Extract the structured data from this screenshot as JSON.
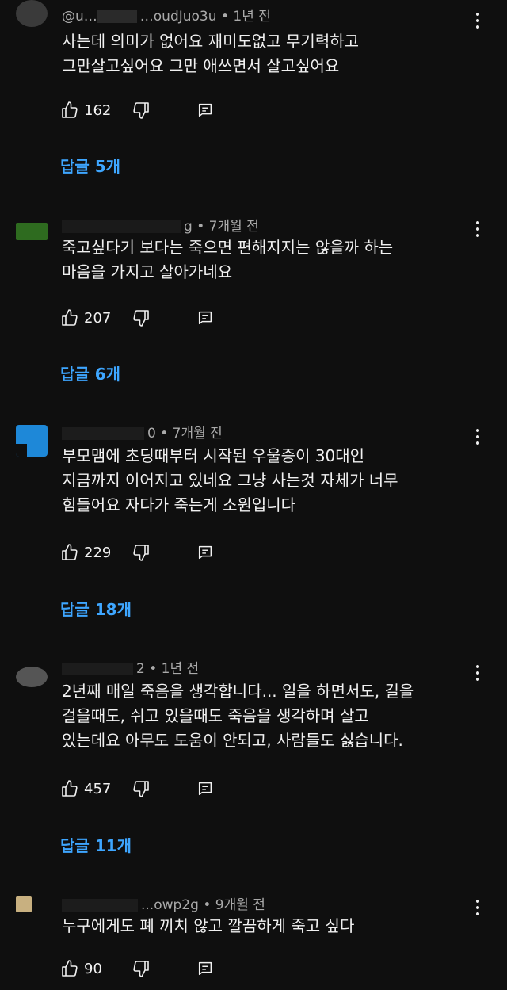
{
  "comments": [
    {
      "author": "@u…",
      "author_tail": "…oudJuo3u",
      "time": "1년 전",
      "text": "사는데 의미가 없어요 재미도없고 무기력하고\n그만살고싶어요 그만 애쓰면서 살고싶어요",
      "likes": "162",
      "replies": "답글 5개",
      "avatar_color": "#3a3a3a"
    },
    {
      "author_tail": "g",
      "time": "7개월 전",
      "text": "죽고싶다기 보다는 죽으면 편해지지는 않을까 하는\n마음을 가지고 살아가네요",
      "likes": "207",
      "replies": "답글 6개",
      "avatar_color": "#2e6b1f"
    },
    {
      "author_tail": "0",
      "time": "7개월 전",
      "text": "부모맴에 초딩때부터 시작된 우울증이 30대인\n지금까지 이어지고 있네요 그냥 사는것 자체가 너무\n힘들어요 자다가 죽는게 소원입니다",
      "likes": "229",
      "replies": "답글 18개",
      "avatar_color": "#1e88d8"
    },
    {
      "author_tail": "2",
      "time": "1년 전",
      "text": "2년째 매일 죽음을 생각합니다... 일을 하면서도, 길을\n걸을때도, 쉬고 있을때도 죽음을 생각하며 살고\n있는데요 아무도 도움이 안되고, 사람들도 싫습니다.",
      "likes": "457",
      "replies": "답글 11개",
      "avatar_color": "#555555"
    },
    {
      "author_tail": "...owp2g",
      "time": "9개월 전",
      "text": "누구에게도 폐 끼치 않고  깔끔하게 죽고 싶다",
      "likes": "90",
      "avatar_color": "#c8b080"
    }
  ],
  "icons": {
    "like": "thumbs-up-icon",
    "dislike": "thumbs-down-icon",
    "reply": "comment-reply-icon",
    "more": "more-vert-icon"
  }
}
